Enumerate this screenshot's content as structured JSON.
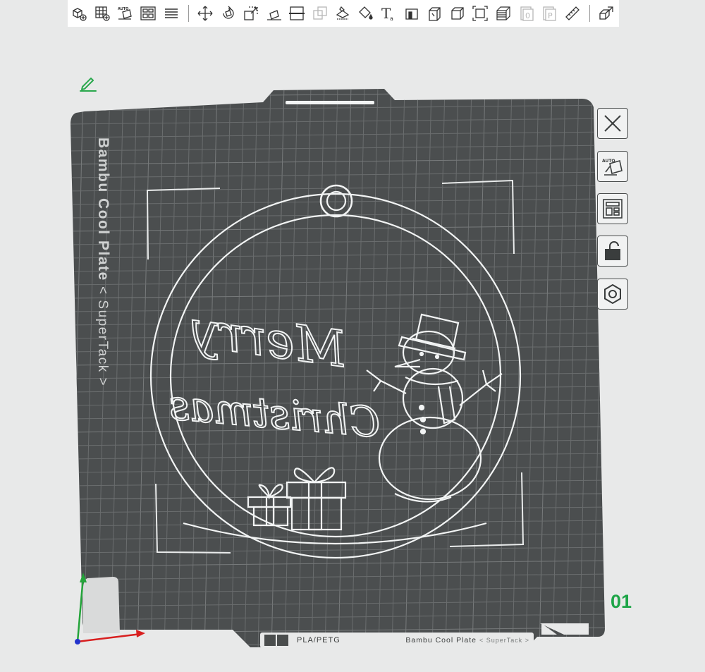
{
  "toolbar": {
    "items": [
      {
        "name": "add-object-icon",
        "tip": "Add"
      },
      {
        "name": "add-plate-icon",
        "tip": "Add plate"
      },
      {
        "name": "auto-orient-icon",
        "tip": "Auto orient",
        "label": "AUTO"
      },
      {
        "name": "arrange-icon",
        "tip": "Arrange"
      },
      {
        "name": "layers-icon",
        "tip": "Layers"
      },
      {
        "name": "move-icon",
        "tip": "Move"
      },
      {
        "name": "rotate-icon",
        "tip": "Rotate"
      },
      {
        "name": "scale-icon",
        "tip": "Scale"
      },
      {
        "name": "lay-on-face-icon",
        "tip": "Lay on face"
      },
      {
        "name": "cut-icon",
        "tip": "Cut"
      },
      {
        "name": "boolean-icon",
        "tip": "Boolean"
      },
      {
        "name": "support-paint-icon",
        "tip": "Support painting"
      },
      {
        "name": "color-paint-icon",
        "tip": "Color painting"
      },
      {
        "name": "text-icon",
        "tip": "Text",
        "label": "T"
      },
      {
        "name": "emboss-icon",
        "tip": "Emboss"
      },
      {
        "name": "assembly-icon",
        "tip": "Assembly"
      },
      {
        "name": "measure-box-icon",
        "tip": "Measure"
      },
      {
        "name": "fit-view-icon",
        "tip": "Fit view"
      },
      {
        "name": "variable-layer-icon",
        "tip": "Variable layer height"
      },
      {
        "name": "object-list-icon",
        "tip": "Objects",
        "label": "0"
      },
      {
        "name": "plate-list-icon",
        "tip": "Plates",
        "label": "P"
      },
      {
        "name": "ruler-icon",
        "tip": "Ruler"
      },
      {
        "name": "split-icon",
        "tip": "Split"
      }
    ]
  },
  "plate": {
    "name": "Bambu Cool Plate",
    "name_sub": "< SuperTack >",
    "number": "01",
    "filament": "PLA/PETG",
    "type_label": "Bambu Cool Plate",
    "type_sub": "< SuperTack >"
  },
  "model": {
    "text_line1": "Merry",
    "text_line2": "Christmas"
  },
  "side_toolbar": [
    {
      "name": "close-plate-icon",
      "tip": "Delete plate"
    },
    {
      "name": "auto-orient-plate-icon",
      "tip": "Auto orient plate",
      "label": "AUTO"
    },
    {
      "name": "arrange-plate-icon",
      "tip": "Arrange plate"
    },
    {
      "name": "lock-plate-icon",
      "tip": "Lock plate"
    },
    {
      "name": "plate-settings-icon",
      "tip": "Plate settings"
    }
  ],
  "colors": {
    "plate": "#4b4e4f",
    "grid": "#6a6d6e",
    "outline": "#f2f4f4",
    "number": "#1ea548",
    "axis_x": "#d81f1f",
    "axis_y": "#24a43a",
    "axis_z": "#2233cc"
  }
}
